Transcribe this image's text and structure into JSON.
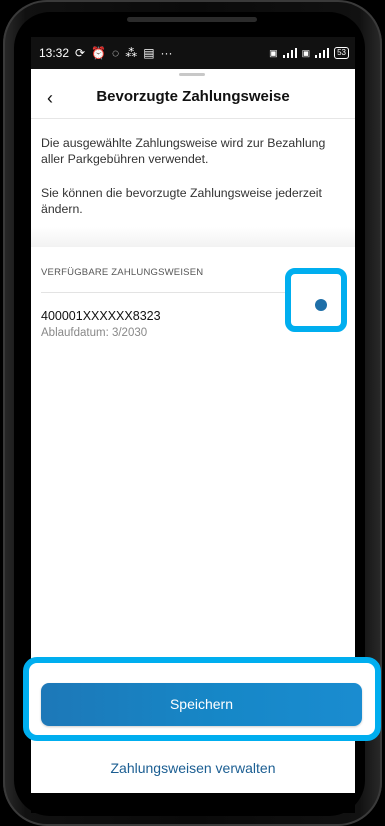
{
  "statusbar": {
    "time": "13:32",
    "notification_icons": [
      "sync-icon",
      "alarm-icon",
      "whatsapp-icon",
      "share-icon",
      "message-icon",
      "more-icon"
    ],
    "battery": "53"
  },
  "header": {
    "title": "Bevorzugte Zahlungsweise",
    "back_icon": "chevron-left-icon"
  },
  "info": {
    "paragraph1": "Die ausgewählte Zahlungsweise wird zur Bezahlung aller Parkgebühren verwendet.",
    "paragraph2": "Sie können die bevorzugte Zahlungsweise jederzeit ändern."
  },
  "payment_methods": {
    "section_title": "VERFÜGBARE ZAHLUNGSWEISEN",
    "items": [
      {
        "number": "400001XXXXXX8323",
        "expiry": "Ablaufdatum: 3/2030",
        "selected": true
      }
    ]
  },
  "actions": {
    "save_label": "Speichern",
    "manage_label": "Zahlungsweisen verwalten"
  },
  "colors": {
    "highlight": "#00aeef",
    "primary_button": "#1687c7",
    "link": "#1b5e92",
    "radio_selected": "#1e6fa8"
  }
}
